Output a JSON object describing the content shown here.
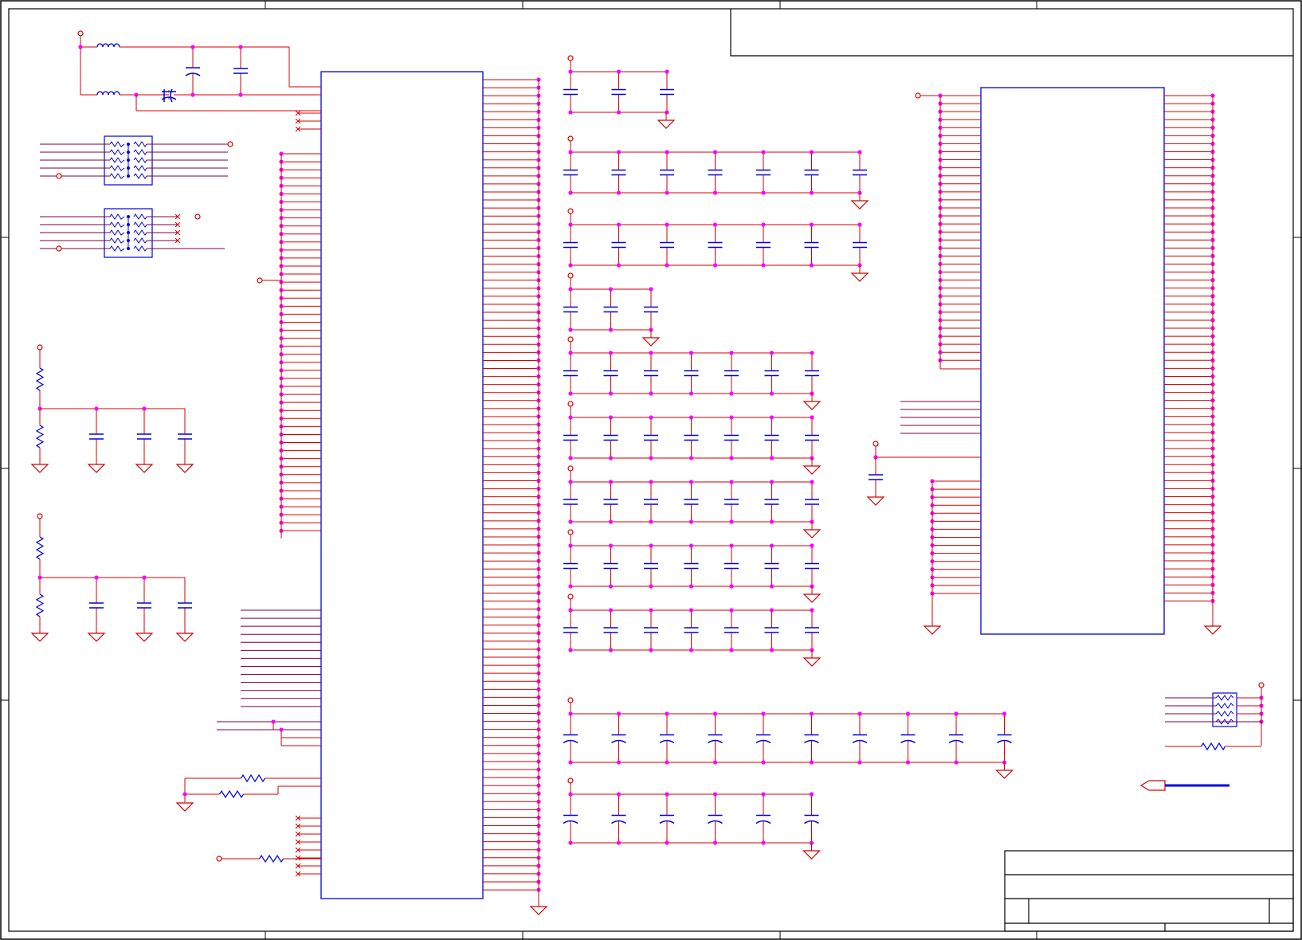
{
  "colors": {
    "wire": "#d40000",
    "net": "#7a0040",
    "component": "#0000e0",
    "junction": "#ff00ff",
    "frame": "#000000",
    "background": "#ffffff"
  },
  "sheet": {
    "title_block_text": "",
    "header_text": ""
  },
  "icons": {
    "resistor": "resistor-icon",
    "capacitor": "capacitor-icon",
    "inductor": "inductor-icon",
    "ground": "ground-icon",
    "power_port": "power-port-icon",
    "chip": "ic-chip-icon",
    "resistor_network": "resistor-network-icon",
    "off_page_connector": "off-page-connector-icon"
  }
}
